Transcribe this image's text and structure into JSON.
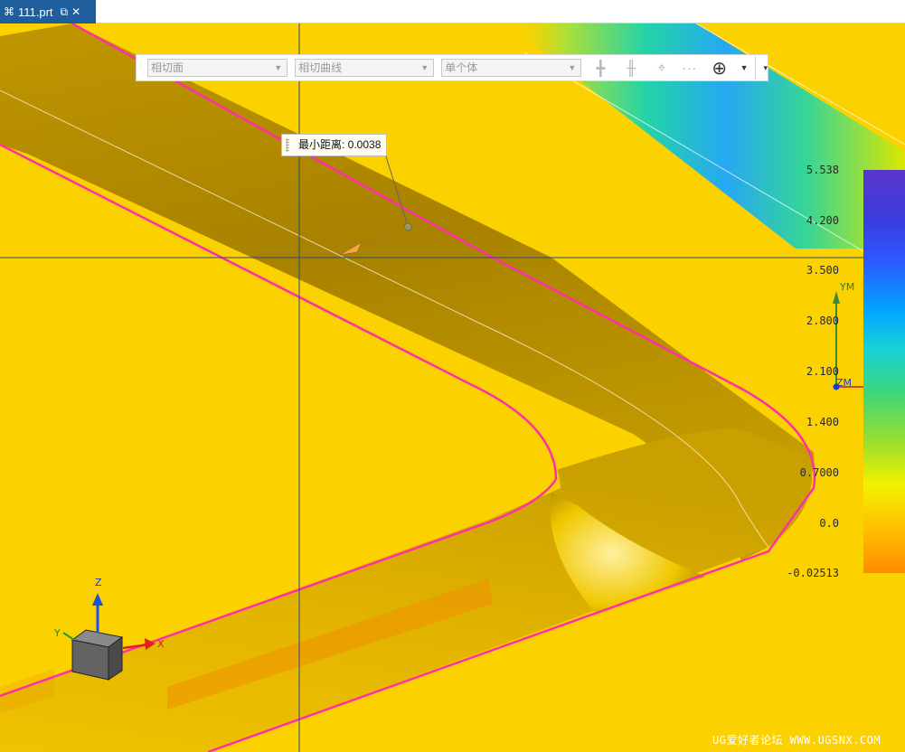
{
  "tab": {
    "icon": "part-file-icon",
    "title": "111.prt",
    "icons": {
      "undock": "undock-icon",
      "close": "close-icon"
    }
  },
  "toolbar": {
    "face_rule": "相切面",
    "curve_rule": "相切曲线",
    "body_rule": "单个体",
    "icons": [
      "snap-cross-icon",
      "snap-multi-cross-icon",
      "snap-point-icon",
      "more-icon",
      "snap-point-target-icon",
      "toolbar-options-icon"
    ]
  },
  "measure_tooltip": {
    "text": "最小距离: 0.0038"
  },
  "deviation_legend": {
    "labels": [
      "5.538",
      "4.200",
      "3.500",
      "2.800",
      "2.100",
      "1.400",
      "0.7000",
      "0.0",
      "-0.02513"
    ]
  },
  "view_triad": {
    "x_label": "X",
    "y_label": "Y",
    "z_label": "Z"
  },
  "wcs": {
    "ym_label": "YM",
    "zm_label": "ZM"
  },
  "watermark": "UG爱好者论坛 WWW.UGSNX.COM",
  "colors": {
    "background": "#fbd200",
    "surface_body": "#b99200",
    "edge_highlight": "#ff2fa8",
    "tab_accent": "#1f5e9c"
  }
}
